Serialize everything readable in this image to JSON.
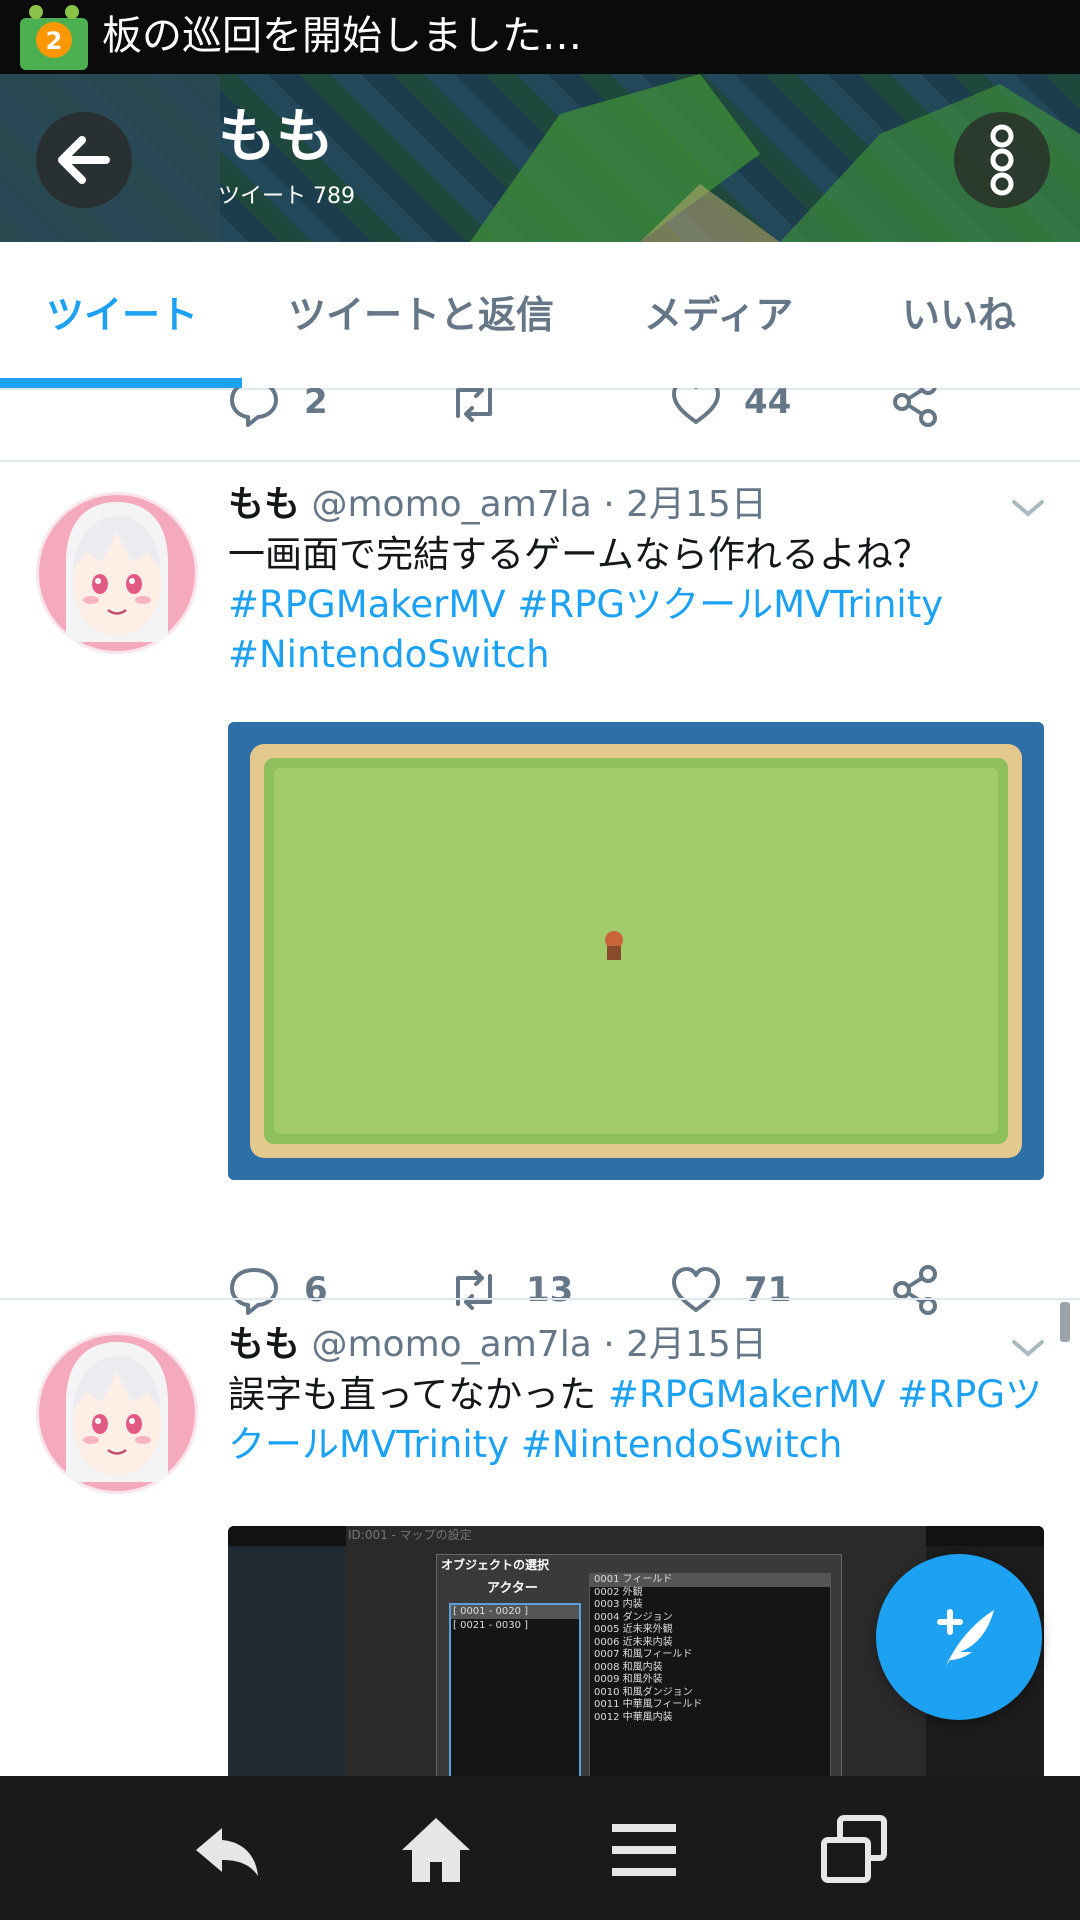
{
  "status_bar": {
    "notification_text": "板の巡回を開始しました…"
  },
  "header": {
    "name": "もも",
    "tweet_count_label": "ツイート 789"
  },
  "tabs": [
    {
      "label": "ツイート",
      "active": true
    },
    {
      "label": "ツイートと返信",
      "active": false
    },
    {
      "label": "メディア",
      "active": false
    },
    {
      "label": "いいね",
      "active": false
    }
  ],
  "top_actions": {
    "replies": "2",
    "retweets": "",
    "likes": "44"
  },
  "tweets": [
    {
      "name": "もも",
      "handle": "@momo_am7la",
      "separator": " · ",
      "date": "2月15日",
      "text": "一画面で完結するゲームなら作れるよね？",
      "hashtags": [
        "#RPGMakerMV",
        "#RPGツクールMVTrinity",
        "#NintendoSwitch"
      ],
      "replies": "6",
      "retweets": "13",
      "likes": "71"
    },
    {
      "name": "もも",
      "handle": "@momo_am7la",
      "separator": " · ",
      "date": "2月15日",
      "text": "誤字も直ってなかった",
      "hashtags": [
        "#RPGMakerMV",
        "#RPGツクールMVTrinity",
        "#NintendoSwitch"
      ],
      "media_title": "オブジェクトの選択",
      "media_column": "アクター",
      "media_actor_rows": [
        "[ 0001 - 0020 ]",
        "[ 0021 - 0030 ]"
      ],
      "media_map_rows": [
        "0001 フィールド",
        "0002 外観",
        "0003 内装",
        "0004 ダンジョン",
        "0005 近未来外観",
        "0006 近未来内装",
        "0007 和風フィールド",
        "0008 和風内装",
        "0009 和風外装",
        "0010 和風ダンジョン",
        "0011 中華風フィールド",
        "0012 中華風内装"
      ],
      "media_bg_title": "ID:001 - マップの設定"
    }
  ],
  "icons": {
    "back": "arrow-left-icon",
    "more": "more-vertical-icon",
    "reply": "reply-icon",
    "retweet": "retweet-icon",
    "like": "heart-icon",
    "share": "share-icon",
    "compose": "compose-tweet-icon",
    "nav": [
      "android-back-icon",
      "home-icon",
      "menu-icon",
      "recent-apps-icon"
    ]
  },
  "colors": {
    "accent": "#1da1f2",
    "muted": "#657786",
    "text": "#14171a"
  }
}
